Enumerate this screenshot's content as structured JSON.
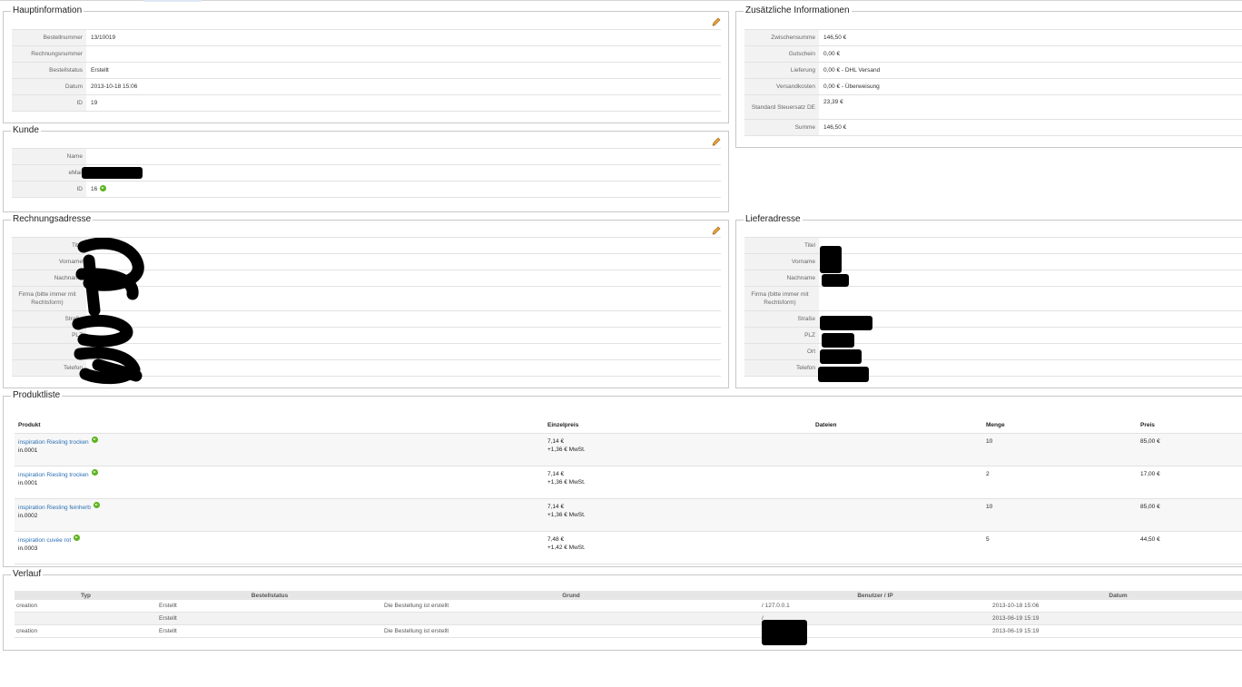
{
  "main_info": {
    "title": "Hauptinformation",
    "rows": [
      {
        "label": "Bestellnummer",
        "value": "13/10019"
      },
      {
        "label": "Rechnungsnummer",
        "value": ""
      },
      {
        "label": "Bestellstatus",
        "value": "Erstellt"
      },
      {
        "label": "Datum",
        "value": "2013-10-18 15:06"
      },
      {
        "label": "ID",
        "value": "19"
      }
    ]
  },
  "extra_info": {
    "title": "Zusätzliche Informationen",
    "rows": [
      {
        "label": "Zwischensumme",
        "value": "146,50 €"
      },
      {
        "label": "Gutschein",
        "value": "0,00 €"
      },
      {
        "label": "Lieferung",
        "value": "0,00 € - DHL Versand"
      },
      {
        "label": "Versandkosten",
        "value": "0,00 € - Überweisung"
      },
      {
        "label": "Standard Steuersatz DE",
        "value": "23,39 €"
      },
      {
        "label": "Summe",
        "value": "146,50 €"
      }
    ]
  },
  "customer": {
    "title": "Kunde",
    "rows": [
      {
        "label": "Name",
        "value": ""
      },
      {
        "label": "eMail",
        "value": ""
      },
      {
        "label": "ID",
        "value": "16"
      }
    ]
  },
  "billing": {
    "title": "Rechnungsadresse",
    "rows": [
      {
        "label": "Titel",
        "value": ""
      },
      {
        "label": "Vorname",
        "value": ""
      },
      {
        "label": "Nachname",
        "value": ""
      },
      {
        "label": "Firma (bitte immer mit Rechtsform)",
        "value": ""
      },
      {
        "label": "Straße",
        "value": ""
      },
      {
        "label": "PLZ",
        "value": ""
      },
      {
        "label": "Ort",
        "value": ""
      },
      {
        "label": "Telefon",
        "value": ""
      }
    ]
  },
  "shipping": {
    "title": "Lieferadresse",
    "rows": [
      {
        "label": "Titel",
        "value": ""
      },
      {
        "label": "Vorname",
        "value": ""
      },
      {
        "label": "Nachname",
        "value": ""
      },
      {
        "label": "Firma (bitte immer mit Rechtsform)",
        "value": ""
      },
      {
        "label": "Straße",
        "value": ""
      },
      {
        "label": "PLZ",
        "value": ""
      },
      {
        "label": "Ort",
        "value": ""
      },
      {
        "label": "Telefon",
        "value": ""
      }
    ]
  },
  "products": {
    "title": "Produktliste",
    "headers": [
      "Produkt",
      "Einzelpreis",
      "Dateien",
      "Menge",
      "Preis"
    ],
    "rows": [
      {
        "name": "inspiration Riesling trocken",
        "sku": "in.0001",
        "unit_price": "7,14 €",
        "tax": "+1,36 € MwSt.",
        "files": "",
        "qty": "10",
        "price": "85,00 €"
      },
      {
        "name": "inspiration Riesling trocken",
        "sku": "in.0001",
        "unit_price": "7,14 €",
        "tax": "+1,36 € MwSt.",
        "files": "",
        "qty": "2",
        "price": "17,00 €"
      },
      {
        "name": "inspiration Riesling feinherb",
        "sku": "in.0002",
        "unit_price": "7,14 €",
        "tax": "+1,36 € MwSt.",
        "files": "",
        "qty": "10",
        "price": "85,00 €"
      },
      {
        "name": "inspiration cuvée rot",
        "sku": "in.0003",
        "unit_price": "7,48 €",
        "tax": "+1,42 € MwSt.",
        "files": "",
        "qty": "5",
        "price": "44,50 €"
      }
    ]
  },
  "history": {
    "title": "Verlauf",
    "headers": [
      "Typ",
      "Bestellstatus",
      "Grund",
      "Benutzer / IP",
      "Datum"
    ],
    "rows": [
      {
        "type": "creation",
        "status": "Erstellt",
        "reason": "Die Bestellung ist erstellt",
        "user": "/ 127.0.0.1",
        "date": "2013-10-18 15:06"
      },
      {
        "type": "",
        "status": "Erstellt",
        "reason": "",
        "user": "/",
        "date": "2013-06-19 15:19"
      },
      {
        "type": "creation",
        "status": "Erstellt",
        "reason": "Die Bestellung ist erstellt",
        "user": "",
        "date": "2013-06-19 15:19"
      }
    ]
  },
  "colors": {
    "link": "#2a6fb3",
    "go_icon": "#5cb31e",
    "label_bg": "#f2f2f2"
  }
}
